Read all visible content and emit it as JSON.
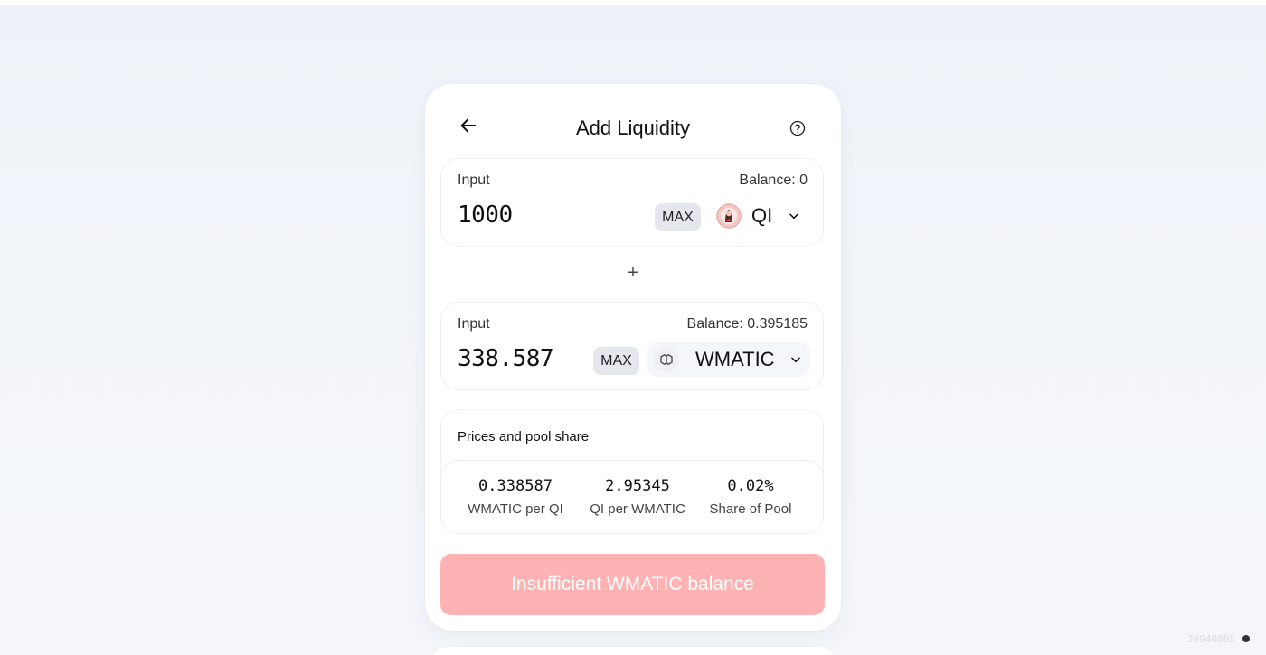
{
  "header": {
    "title": "Add Liquidity",
    "back_icon": "arrow-left-icon",
    "help_icon": "question-circle-icon"
  },
  "token_a": {
    "label": "Input",
    "balance": "Balance: 0",
    "amount": "1000",
    "max_label": "MAX",
    "symbol": "QI",
    "icon": "qi-token-icon"
  },
  "plus_symbol": "+",
  "token_b": {
    "label": "Input",
    "balance": "Balance: 0.395185",
    "amount": "338.587",
    "max_label": "MAX",
    "symbol": "WMATIC",
    "icon": "wmatic-token-icon"
  },
  "prices": {
    "title": "Prices and pool share",
    "stats": [
      {
        "value": "0.338587",
        "label": "WMATIC per QI"
      },
      {
        "value": "2.95345",
        "label": "QI per WMATIC"
      },
      {
        "value": "0.02%",
        "label": "Share of Pool"
      }
    ]
  },
  "cta": {
    "label": "Insufficient WMATIC balance",
    "color": "#ffb2b4"
  },
  "footer": {
    "build": "20940805"
  }
}
